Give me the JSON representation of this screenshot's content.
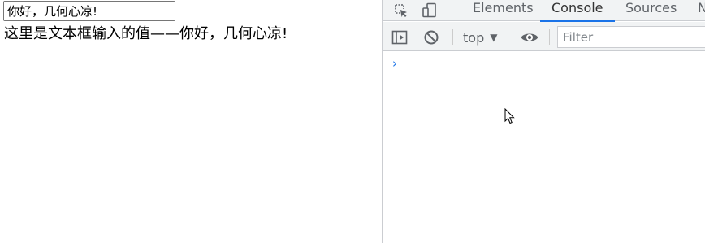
{
  "page": {
    "input_value": "你好，几何心凉!",
    "echo_text": "这里是文本框输入的值——你好，几何心凉!"
  },
  "devtools": {
    "tabs": [
      {
        "label": "Elements",
        "active": false
      },
      {
        "label": "Console",
        "active": true
      },
      {
        "label": "Sources",
        "active": false
      },
      {
        "label": "N",
        "active": false
      }
    ],
    "toolbar": {
      "context": "top",
      "filter_placeholder": "Filter"
    },
    "console": {
      "prompt_symbol": "›"
    },
    "icons": {
      "inspect": "inspect-element-icon",
      "device": "device-toolbar-icon",
      "sidebar": "show-console-sidebar-icon",
      "clear": "clear-console-icon",
      "eye": "live-expression-icon"
    },
    "colors": {
      "active_tab_underline": "#1a73e8",
      "toolbar_bg": "#f1f3f4",
      "prompt": "#1a73e8"
    }
  }
}
